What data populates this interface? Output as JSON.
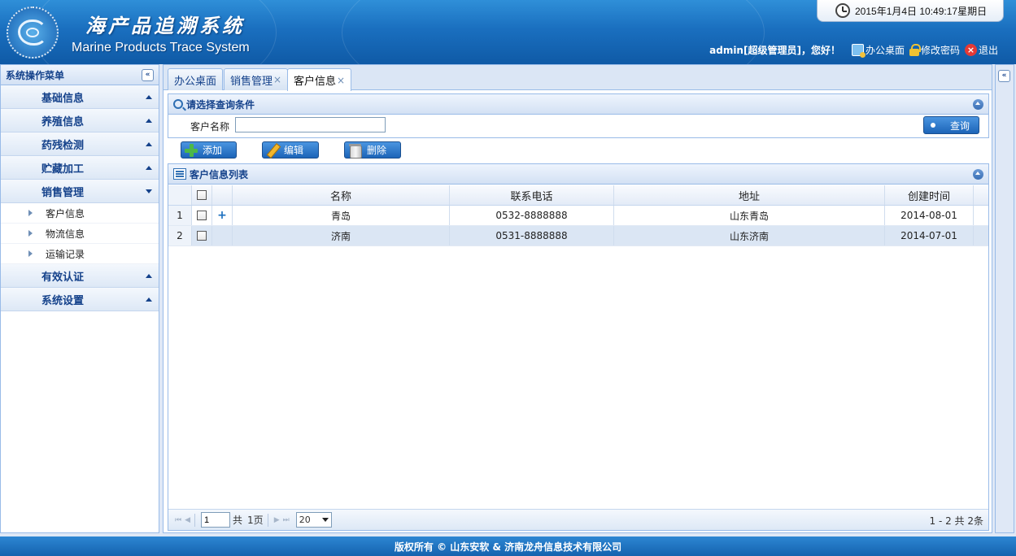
{
  "header": {
    "title_cn": "海产品追溯系统",
    "title_en": "Marine Products Trace System",
    "clock": "2015年1月4日  10:49:17星期日",
    "user": "admin[超级管理员]，您好！",
    "links": {
      "desktop": "办公桌面",
      "password": "修改密码",
      "logout": "退出"
    }
  },
  "sidebar": {
    "title": "系统操作菜单",
    "collapse_glyph": "«",
    "groups": [
      {
        "label": "基础信息",
        "expanded": false
      },
      {
        "label": "养殖信息",
        "expanded": false
      },
      {
        "label": "药残检测",
        "expanded": false
      },
      {
        "label": "贮藏加工",
        "expanded": false
      },
      {
        "label": "销售管理",
        "expanded": true,
        "items": [
          "客户信息",
          "物流信息",
          "运输记录"
        ]
      },
      {
        "label": "有效认证",
        "expanded": false
      },
      {
        "label": "系统设置",
        "expanded": false
      }
    ]
  },
  "tabs": [
    {
      "label": "办公桌面",
      "closable": false
    },
    {
      "label": "销售管理",
      "closable": true
    },
    {
      "label": "客户信息",
      "closable": true,
      "active": true
    }
  ],
  "tab_close": "×",
  "query": {
    "title": "请选择查询条件",
    "label": "客户名称",
    "value": "",
    "button": "查询"
  },
  "toolbar": {
    "add": "添加",
    "edit": "编辑",
    "delete": "删除"
  },
  "grid": {
    "title": "客户信息列表",
    "columns": [
      "名称",
      "联系电话",
      "地址",
      "创建时间"
    ],
    "rows": [
      {
        "num": "1",
        "name": "青岛",
        "tel": "0532-8888888",
        "addr": "山东青岛",
        "date": "2014-08-01",
        "expander": "+"
      },
      {
        "num": "2",
        "name": "济南",
        "tel": "0531-8888888",
        "addr": "山东济南",
        "date": "2014-07-01",
        "expander": ""
      }
    ]
  },
  "pager": {
    "first": "⏮",
    "prev": "◀",
    "next": "▶",
    "last": "⏭",
    "page": "1",
    "total_prefix": "共",
    "total_pages": "1页",
    "page_size": "20",
    "summary": "1 - 2  共 2条"
  },
  "footer": "版权所有 © 山东安软 & 济南龙舟信息技术有限公司"
}
